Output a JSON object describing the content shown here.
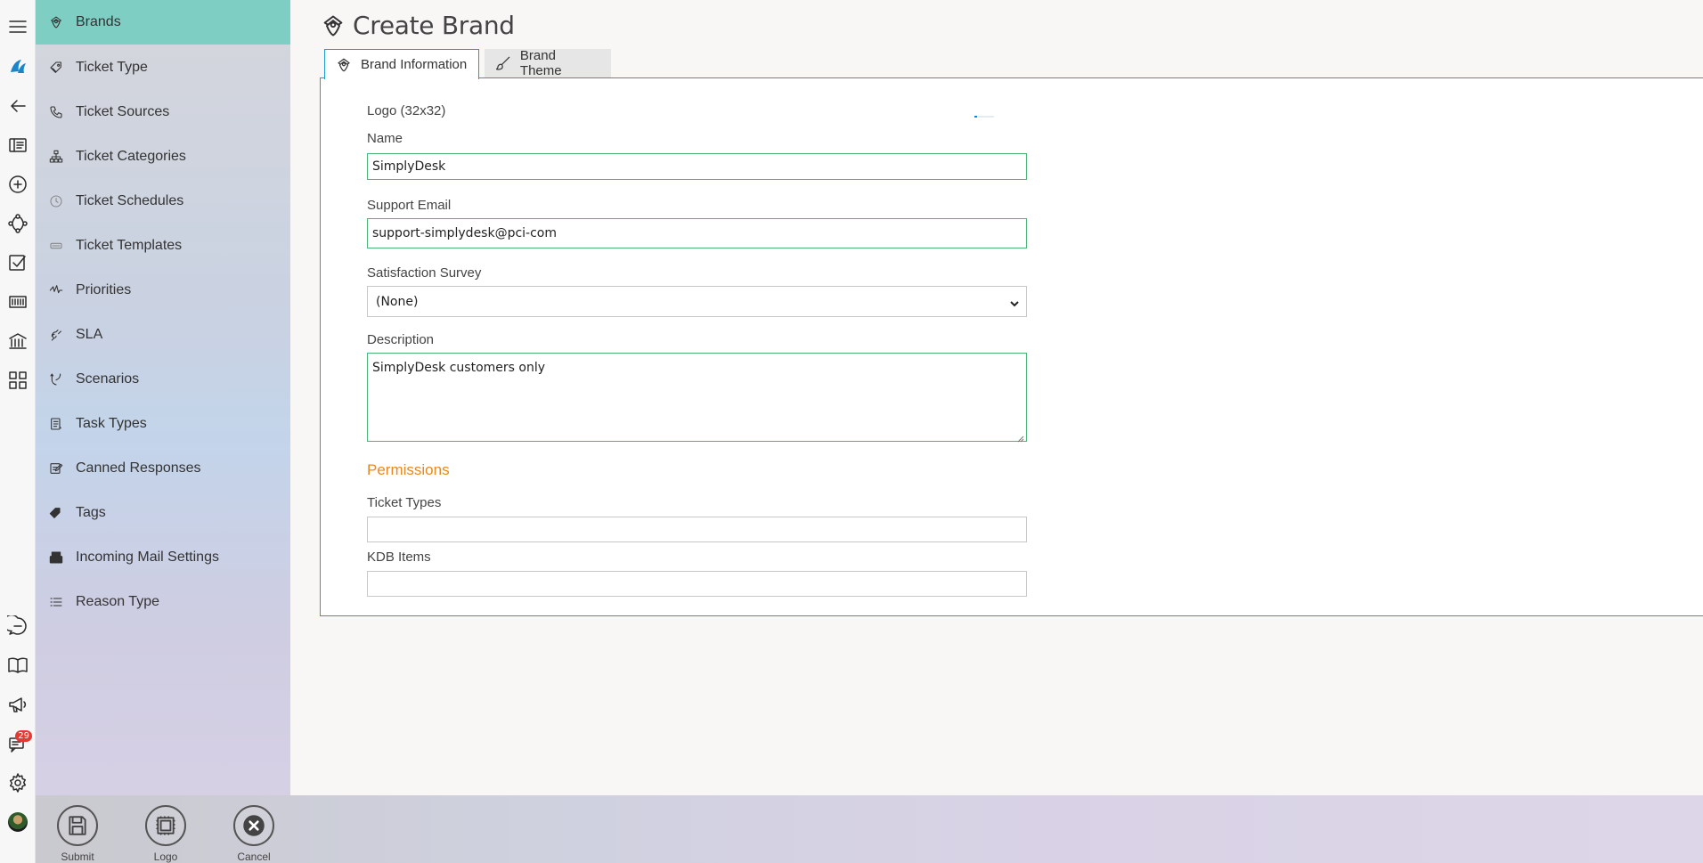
{
  "page": {
    "title": "Create Brand"
  },
  "tabs": [
    {
      "label": "Brand Information",
      "icon": "brand-icon"
    },
    {
      "label": "Brand Theme",
      "icon": "brush-icon"
    }
  ],
  "sidemenu": {
    "items": [
      {
        "label": "Brands",
        "icon": "brand-icon",
        "active": true
      },
      {
        "label": "Ticket Type",
        "icon": "tag-outline-icon"
      },
      {
        "label": "Ticket Sources",
        "icon": "phone-icon"
      },
      {
        "label": "Ticket Categories",
        "icon": "hierarchy-icon"
      },
      {
        "label": "Ticket Schedules",
        "icon": "clock-icon"
      },
      {
        "label": "Ticket Templates",
        "icon": "template-icon"
      },
      {
        "label": "Priorities",
        "icon": "priority-icon"
      },
      {
        "label": "SLA",
        "icon": "sla-icon"
      },
      {
        "label": "Scenarios",
        "icon": "scenario-icon"
      },
      {
        "label": "Task Types",
        "icon": "task-icon"
      },
      {
        "label": "Canned Responses",
        "icon": "edit-note-icon"
      },
      {
        "label": "Tags",
        "icon": "tags-icon"
      },
      {
        "label": "Incoming Mail Settings",
        "icon": "mail-settings-icon"
      },
      {
        "label": "Reason Type",
        "icon": "list-icon"
      }
    ]
  },
  "form": {
    "logo_label": "Logo (32x32)",
    "name_label": "Name",
    "name_value": "SimplyDesk",
    "email_label": "Support Email",
    "email_value": "support-simplydesk@pci-com",
    "survey_label": "Satisfaction Survey",
    "survey_value": "(None)",
    "description_label": "Description",
    "description_value": "SimplyDesk customers only",
    "permissions_title": "Permissions",
    "ticket_types_label": "Ticket Types",
    "ticket_types_value": "",
    "kdb_label": "KDB Items",
    "kdb_value": ""
  },
  "rail": {
    "notification_count": "29"
  },
  "actions": [
    {
      "label": "Submit",
      "icon": "save-icon"
    },
    {
      "label": "Logo",
      "icon": "logo-stamp-icon"
    },
    {
      "label": "Cancel",
      "icon": "cancel-icon"
    }
  ],
  "colors": {
    "active_menu": "#7fcec4",
    "tab_border": "#1a9fd0",
    "valid_border": "#4db57a",
    "section_title": "#e6891f"
  }
}
